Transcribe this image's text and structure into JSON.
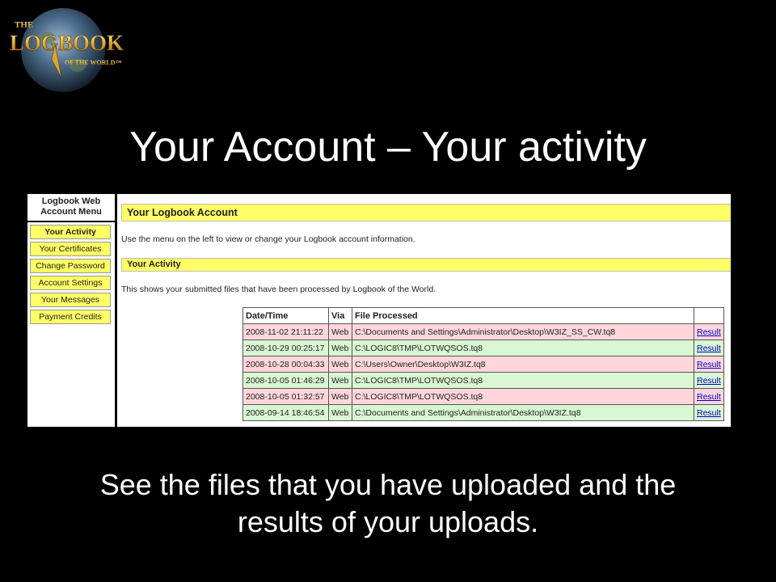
{
  "logo": {
    "line_the": "THE",
    "line_logbook": "LOGBOOK",
    "line_world": "OF THE WORLD™"
  },
  "slide_title": "Your Account – Your activity",
  "menu": {
    "title_line1": "Logbook Web",
    "title_line2": "Account Menu",
    "items": [
      "Your Activity",
      "Your Certificates",
      "Change Password",
      "Account Settings",
      "Your Messages",
      "Payment Credits"
    ]
  },
  "account_header": "Your Logbook Account",
  "account_note": "Use the menu on the left to view or change your Logbook account information.",
  "activity_header": "Your Activity",
  "activity_note": "This shows your submitted files that have been processed by Logbook of the World.",
  "table": {
    "headers": [
      "Date/Time",
      "Via",
      "File Processed",
      ""
    ],
    "rows": [
      {
        "datetime": "2008-11-02 21:11:22",
        "via": "Web",
        "file": "C:\\Documents and Settings\\Administrator\\Desktop\\W3IZ_SS_CW.tq8",
        "result": "Result",
        "status": "pink"
      },
      {
        "datetime": "2008-10-29 00:25:17",
        "via": "Web",
        "file": "C:\\LOGIC8\\TMP\\LOTWQSOS.tq8",
        "result": "Result",
        "status": "green"
      },
      {
        "datetime": "2008-10-28 00:04:33",
        "via": "Web",
        "file": "C:\\Users\\Owner\\Desktop\\W3IZ.tq8",
        "result": "Result",
        "status": "pink"
      },
      {
        "datetime": "2008-10-05 01:46:29",
        "via": "Web",
        "file": "C:\\LOGIC8\\TMP\\LOTWQSOS.tq8",
        "result": "Result",
        "status": "green"
      },
      {
        "datetime": "2008-10-05 01:32:57",
        "via": "Web",
        "file": "C:\\LOGIC8\\TMP\\LOTWQSOS.tq8",
        "result": "Result",
        "status": "pink"
      },
      {
        "datetime": "2008-09-14 18:46:54",
        "via": "Web",
        "file": "C:\\Documents and Settings\\Administrator\\Desktop\\W3IZ.tq8",
        "result": "Result",
        "status": "green"
      }
    ]
  },
  "caption_line1": "See the files that you have uploaded and the",
  "caption_line2": "results of your uploads.",
  "colors": {
    "menu_yellow": "#ffff66",
    "row_pink": "#ffd6dc",
    "row_green": "#d9f7d2",
    "link_blue": "#0000cc"
  }
}
